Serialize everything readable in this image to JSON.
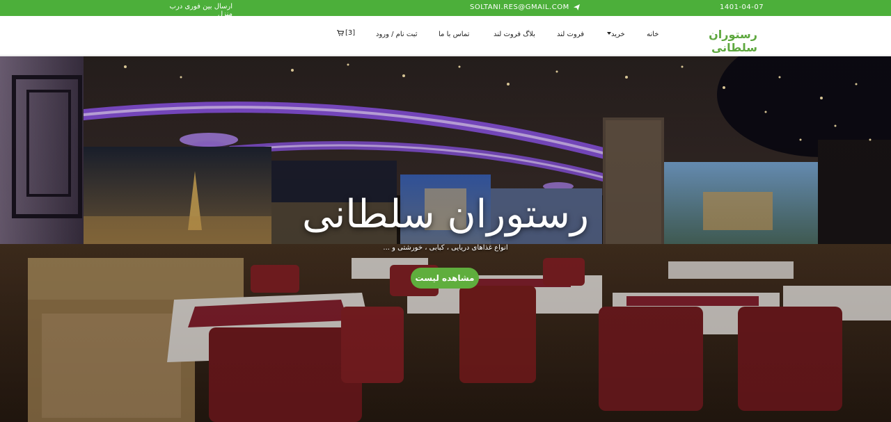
{
  "topbar": {
    "date": "1401-04-07",
    "email": "SOLTANI.RES@GMAIL.COM",
    "email_icon": "paper-plane-icon",
    "delivery": "ارسال بین فوری درب منزل",
    "bg_color": "#4caf3a"
  },
  "navbar": {
    "brand": "رستوران سلطانی",
    "brand_color": "#5ea83f",
    "items": [
      {
        "label": "خانه"
      },
      {
        "label": "خرید"
      },
      {
        "label": "فروت لند"
      },
      {
        "label": "بلاگ فروت لند"
      },
      {
        "label": "تماس با ما"
      },
      {
        "label": "ثبت نام / ورود"
      }
    ],
    "cart": {
      "icon": "shopping-cart-icon",
      "count": "[3]"
    }
  },
  "hero": {
    "title": "رستوران سلطانی",
    "subtitle": "انواع غذاهای دریایی ، کبابی ، خورشتی و ...",
    "button": "مشاهده لیست",
    "button_color": "#5fae3d"
  }
}
